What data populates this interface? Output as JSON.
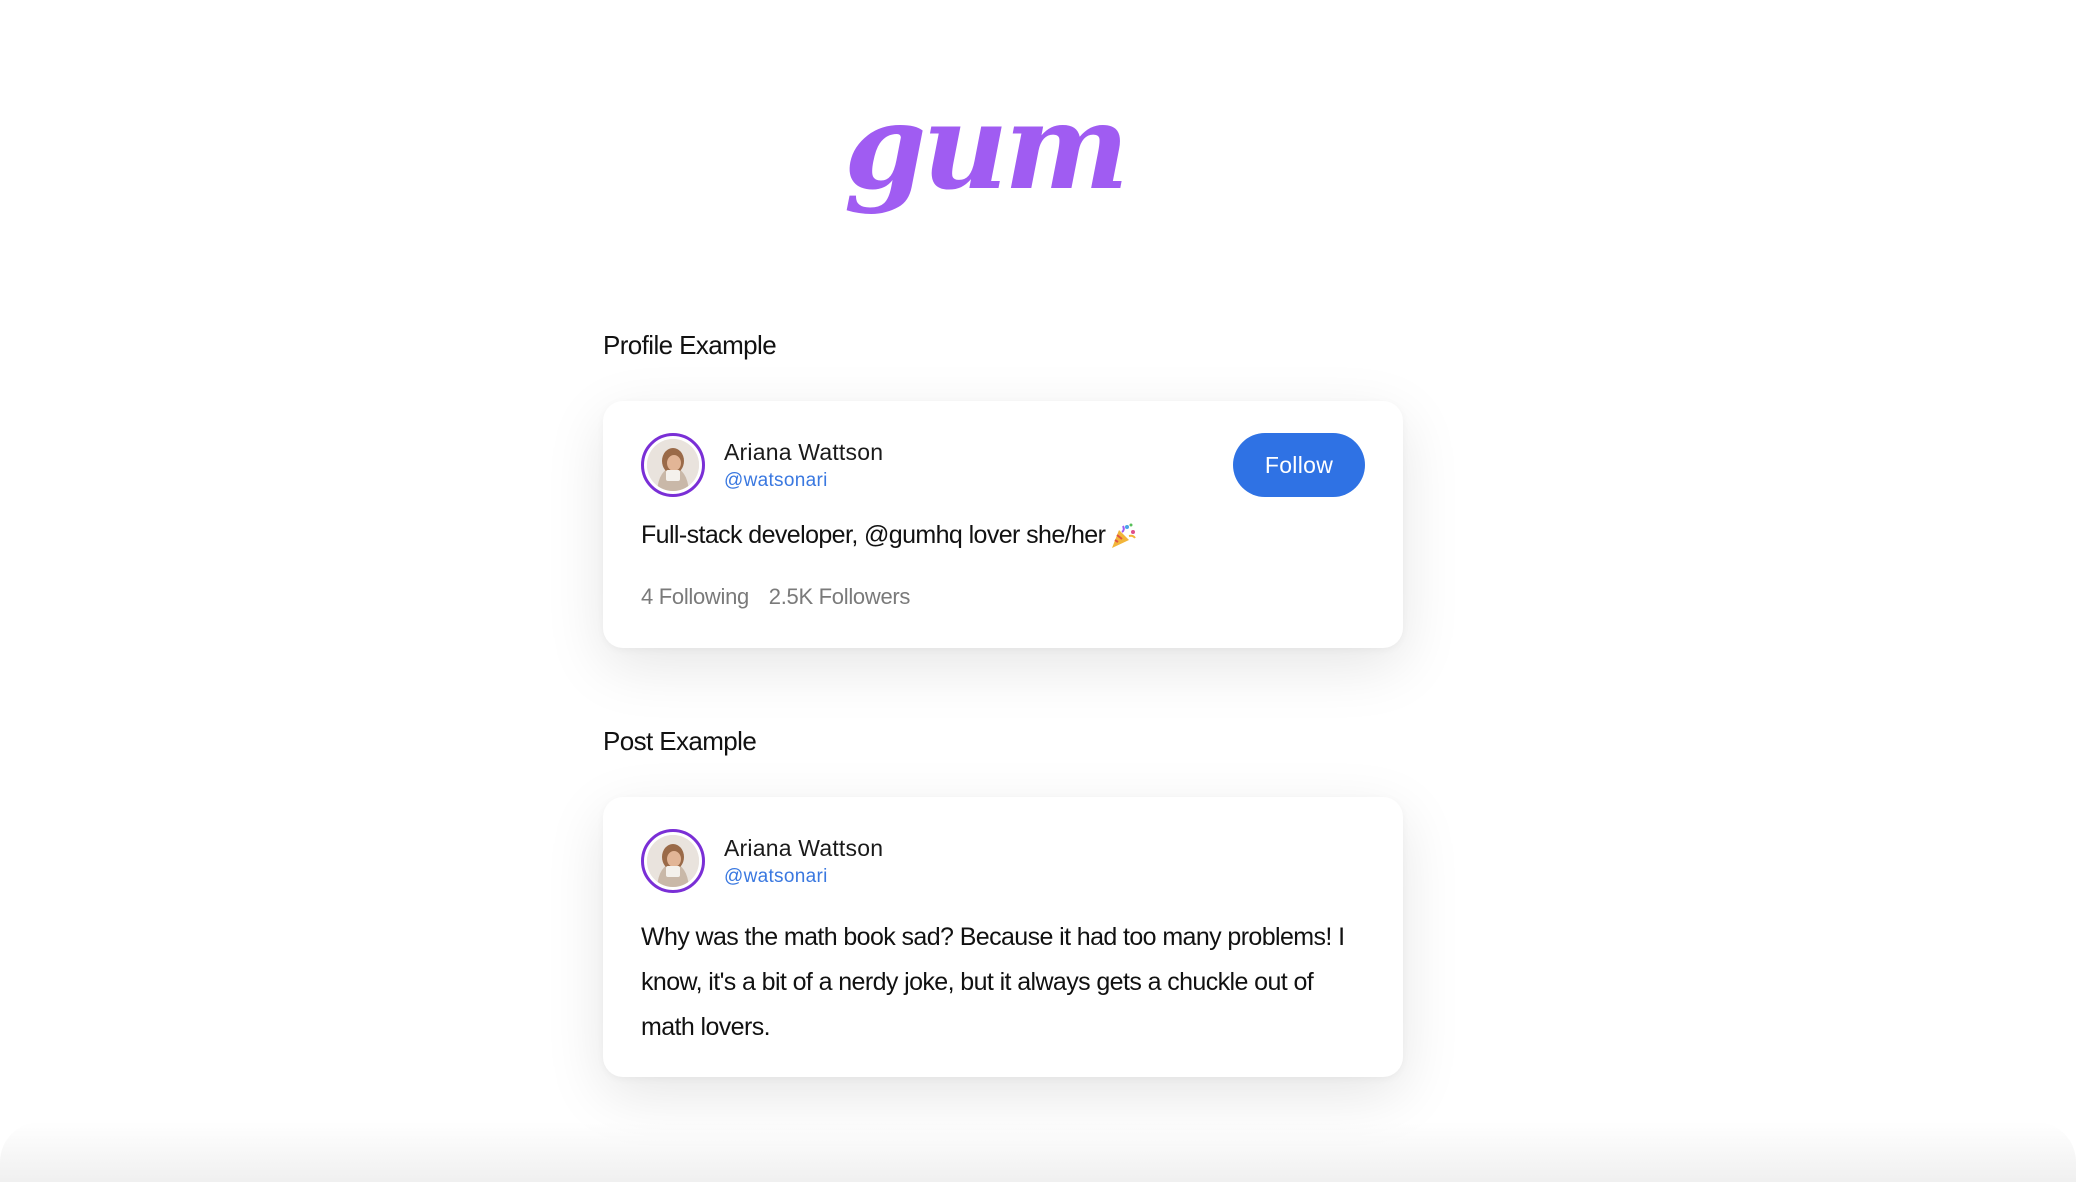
{
  "logo": {
    "text": "gum",
    "color": "#a05cf2"
  },
  "profile_section": {
    "title": "Profile Example"
  },
  "profile_card": {
    "name": "Ariana Wattson",
    "handle": "@watsonari",
    "follow_label": "Follow",
    "bio": "Full-stack developer, @gumhq lover she/her",
    "bio_icon": "party-popper-icon",
    "following": "4 Following",
    "followers": "2.5K Followers"
  },
  "post_section": {
    "title": "Post Example"
  },
  "post_card": {
    "name": "Ariana Wattson",
    "handle": "@watsonari",
    "text": "Why was the math book sad? Because it had too many problems! I know, it's a bit of a nerdy joke, but it always gets a chuckle out of math lovers."
  },
  "colors": {
    "accent": "#2f72e4",
    "avatar_ring": "#7a2fd6",
    "handle": "#3a78e0",
    "muted": "#7a7a7a"
  }
}
